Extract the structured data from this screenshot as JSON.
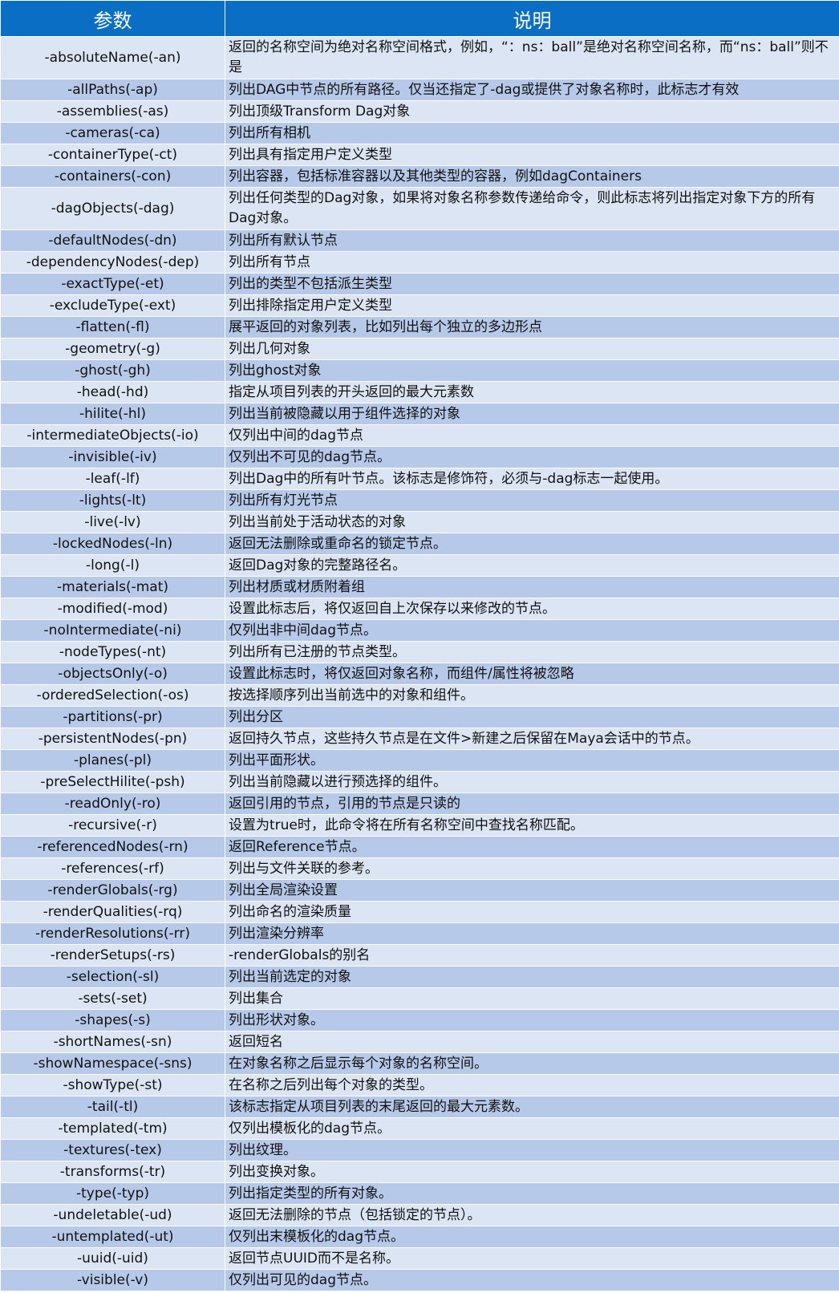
{
  "header": {
    "col_param": "参数",
    "col_desc": "说明"
  },
  "rows": [
    {
      "param": "-absoluteName(-an)",
      "desc": "返回的名称空间为绝对名称空间格式，例如，“：ns：ball”是绝对名称空间名称，而“ns：ball”则不是"
    },
    {
      "param": "-allPaths(-ap)",
      "desc": "列出DAG中节点的所有路径。仅当还指定了-dag或提供了对象名称时，此标志才有效"
    },
    {
      "param": "-assemblies(-as)",
      "desc": "列出顶级Transform Dag对象"
    },
    {
      "param": "-cameras(-ca)",
      "desc": "列出所有相机"
    },
    {
      "param": "-containerType(-ct)",
      "desc": "列出具有指定用户定义类型"
    },
    {
      "param": "-containers(-con)",
      "desc": "列出容器，包括标准容器以及其他类型的容器，例如dagContainers"
    },
    {
      "param": "-dagObjects(-dag)",
      "desc": "列出任何类型的Dag对象，如果将对象名称参数传递给命令，则此标志将列出指定对象下方的所有Dag对象。"
    },
    {
      "param": "-defaultNodes(-dn)",
      "desc": "列出所有默认节点"
    },
    {
      "param": "-dependencyNodes(-dep)",
      "desc": "列出所有节点"
    },
    {
      "param": "-exactType(-et)",
      "desc": "列出的类型不包括派生类型"
    },
    {
      "param": "-excludeType(-ext)",
      "desc": "列出排除指定用户定义类型"
    },
    {
      "param": "-flatten(-fl)",
      "desc": "展平返回的对象列表，比如列出每个独立的多边形点"
    },
    {
      "param": "-geometry(-g)",
      "desc": "列出几何对象"
    },
    {
      "param": "-ghost(-gh)",
      "desc": "列出ghost对象"
    },
    {
      "param": "-head(-hd)",
      "desc": "指定从项目列表的开头返回的最大元素数"
    },
    {
      "param": "-hilite(-hl)",
      "desc": "列出当前被隐藏以用于组件选择的对象"
    },
    {
      "param": "-intermediateObjects(-io)",
      "desc": "仅列出中间的dag节点"
    },
    {
      "param": "-invisible(-iv)",
      "desc": "仅列出不可见的dag节点。"
    },
    {
      "param": "-leaf(-lf)",
      "desc": "列出Dag中的所有叶节点。该标志是修饰符，必须与-dag标志一起使用。"
    },
    {
      "param": "-lights(-lt)",
      "desc": "列出所有灯光节点"
    },
    {
      "param": "-live(-lv)",
      "desc": "列出当前处于活动状态的对象"
    },
    {
      "param": "-lockedNodes(-ln)",
      "desc": "返回无法删除或重命名的锁定节点。"
    },
    {
      "param": "-long(-l)",
      "desc": "返回Dag对象的完整路径名。"
    },
    {
      "param": "-materials(-mat)",
      "desc": "列出材质或材质附着组"
    },
    {
      "param": "-modified(-mod)",
      "desc": "设置此标志后，将仅返回自上次保存以来修改的节点。"
    },
    {
      "param": "-noIntermediate(-ni)",
      "desc": "仅列出非中间dag节点。"
    },
    {
      "param": "-nodeTypes(-nt)",
      "desc": "列出所有已注册的节点类型。"
    },
    {
      "param": "-objectsOnly(-o)",
      "desc": "设置此标志时，将仅返回对象名称，而组件/属性将被忽略"
    },
    {
      "param": "-orderedSelection(-os)",
      "desc": "按选择顺序列出当前选中的对象和组件。"
    },
    {
      "param": "-partitions(-pr)",
      "desc": "列出分区"
    },
    {
      "param": "-persistentNodes(-pn)",
      "desc": "返回持久节点，这些持久节点是在文件>新建之后保留在Maya会话中的节点。"
    },
    {
      "param": "-planes(-pl)",
      "desc": "列出平面形状。"
    },
    {
      "param": "-preSelectHilite(-psh)",
      "desc": "列出当前隐藏以进行预选择的组件。"
    },
    {
      "param": "-readOnly(-ro)",
      "desc": "返回引用的节点，引用的节点是只读的"
    },
    {
      "param": "-recursive(-r)",
      "desc": "设置为true时，此命令将在所有名称空间中查找名称匹配。"
    },
    {
      "param": "-referencedNodes(-rn)",
      "desc": "返回Reference节点。"
    },
    {
      "param": "-references(-rf)",
      "desc": "列出与文件关联的参考。"
    },
    {
      "param": "-renderGlobals(-rg)",
      "desc": "列出全局渲染设置"
    },
    {
      "param": "-renderQualities(-rq)",
      "desc": "列出命名的渲染质量"
    },
    {
      "param": "-renderResolutions(-rr)",
      "desc": "列出渲染分辨率"
    },
    {
      "param": "-renderSetups(-rs)",
      "desc": "-renderGlobals的别名"
    },
    {
      "param": "-selection(-sl)",
      "desc": "列出当前选定的对象"
    },
    {
      "param": "-sets(-set)",
      "desc": "列出集合"
    },
    {
      "param": "-shapes(-s)",
      "desc": "列出形状对象。"
    },
    {
      "param": "-shortNames(-sn)",
      "desc": "返回短名"
    },
    {
      "param": "-showNamespace(-sns)",
      "desc": "在对象名称之后显示每个对象的名称空间。"
    },
    {
      "param": "-showType(-st)",
      "desc": "在名称之后列出每个对象的类型。"
    },
    {
      "param": "-tail(-tl)",
      "desc": "该标志指定从项目列表的末尾返回的最大元素数。"
    },
    {
      "param": "-templated(-tm)",
      "desc": "仅列出模板化的dag节点。"
    },
    {
      "param": "-textures(-tex)",
      "desc": "列出纹理。"
    },
    {
      "param": "-transforms(-tr)",
      "desc": "列出变换对象。"
    },
    {
      "param": "-type(-typ)",
      "desc": "列出指定类型的所有对象。"
    },
    {
      "param": "-undeletable(-ud)",
      "desc": "返回无法删除的节点（包括锁定的节点）。"
    },
    {
      "param": "-untemplated(-ut)",
      "desc": "仅列出末模板化的dag节点。"
    },
    {
      "param": "-uuid(-uid)",
      "desc": "返回节点UUID而不是名称。"
    },
    {
      "param": "-visible(-v)",
      "desc": "仅列出可见的dag节点。"
    }
  ]
}
